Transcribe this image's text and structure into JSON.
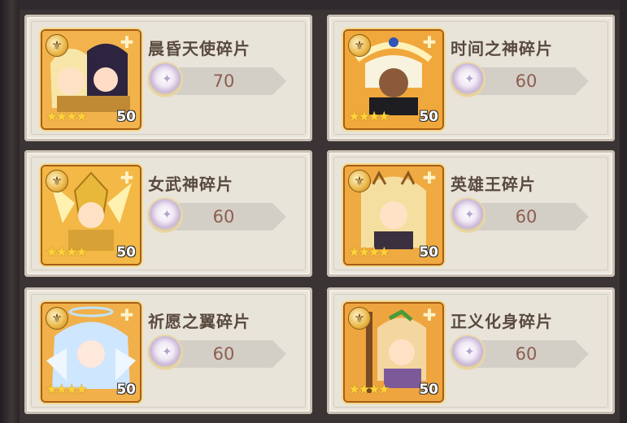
{
  "cards": [
    {
      "name": "晨昏天使碎片",
      "count": "70",
      "level": "50",
      "stars": "★★★★",
      "art": "dual-angel-art"
    },
    {
      "name": "时间之神碎片",
      "count": "60",
      "level": "50",
      "stars": "★★★★",
      "art": "time-god-art"
    },
    {
      "name": "女武神碎片",
      "count": "60",
      "level": "50",
      "stars": "★★★★",
      "art": "valkyrie-art"
    },
    {
      "name": "英雄王碎片",
      "count": "60",
      "level": "50",
      "stars": "★★★★",
      "art": "hero-king-art"
    },
    {
      "name": "祈愿之翼碎片",
      "count": "60",
      "level": "50",
      "stars": "★★★★",
      "art": "wish-wing-art"
    },
    {
      "name": "正义化身碎片",
      "count": "60",
      "level": "50",
      "stars": "★★★★",
      "art": "justice-avatar-art"
    }
  ],
  "icons": {
    "badge": "wing-emblem-icon",
    "corner": "puzzle-piece-icon",
    "shard": "shard-crystal-icon"
  }
}
